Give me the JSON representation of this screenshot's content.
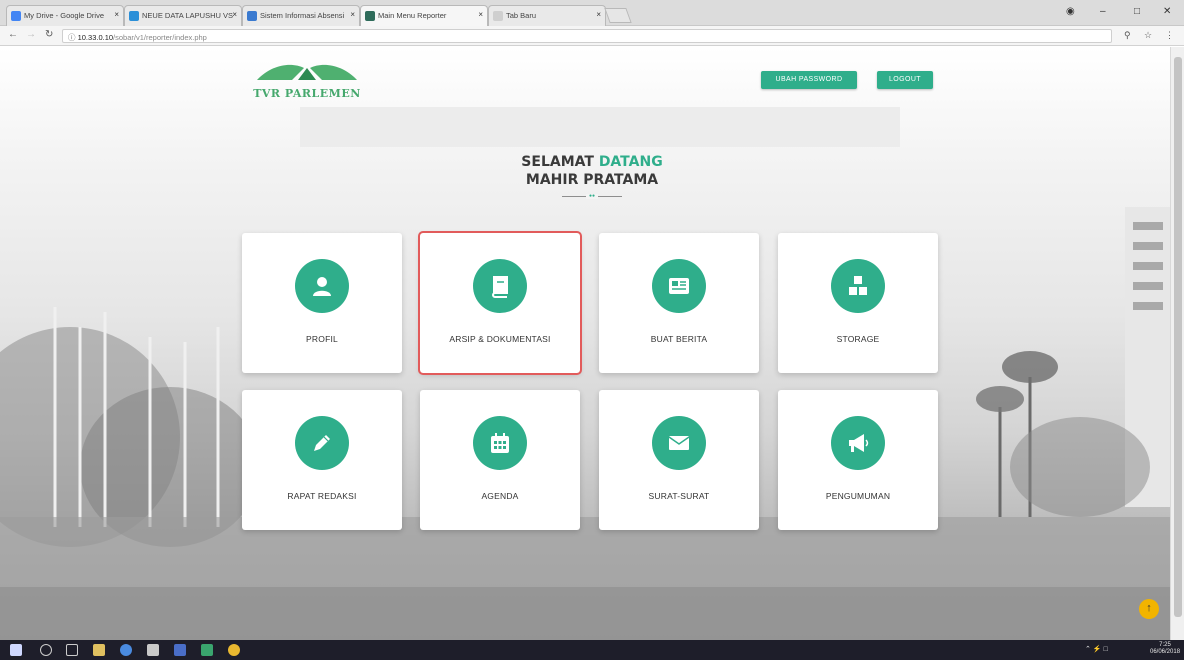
{
  "browser": {
    "tabs": [
      {
        "title": "My Drive - Google Drive",
        "active": false
      },
      {
        "title": "NEUE DATA LAPUSHU VS",
        "active": false
      },
      {
        "title": "Sistem Informasi Absensi",
        "active": false
      },
      {
        "title": "Main Menu Reporter",
        "active": true
      },
      {
        "title": "Tab Baru",
        "active": false
      }
    ],
    "address_host": "10.33.0.10",
    "address_path": "/sobar/v1/reporter/index.php",
    "window_controls": {
      "minimize": "–",
      "maximize": "□",
      "close": "✕"
    }
  },
  "header": {
    "logo_text": "TVR PARLEMEN",
    "buttons": [
      {
        "label": "UBAH PASSWORD"
      },
      {
        "label": "LOGOUT"
      }
    ]
  },
  "welcome": {
    "greeting": "SELAMAT ",
    "greeting_highlight": "DATANG",
    "username": "MAHIR PRATAMA"
  },
  "menu": [
    {
      "label": "PROFIL",
      "icon": "user-icon"
    },
    {
      "label": "ARSIP & DOKUMENTASI",
      "icon": "book-icon",
      "selected": true
    },
    {
      "label": "BUAT BERITA",
      "icon": "newspaper-icon"
    },
    {
      "label": "STORAGE",
      "icon": "cubes-icon"
    },
    {
      "label": "RAPAT REDAKSI",
      "icon": "pencil-icon"
    },
    {
      "label": "AGENDA",
      "icon": "calendar-icon"
    },
    {
      "label": "SURAT-SURAT",
      "icon": "envelope-icon"
    },
    {
      "label": "PENGUMUMAN",
      "icon": "megaphone-icon"
    }
  ],
  "colors": {
    "accent": "#2fae8b",
    "selection": "#e25b5b",
    "scroll_top": "#f2b400"
  },
  "taskbar": {
    "time": "7:25",
    "date": "06/06/2018"
  }
}
